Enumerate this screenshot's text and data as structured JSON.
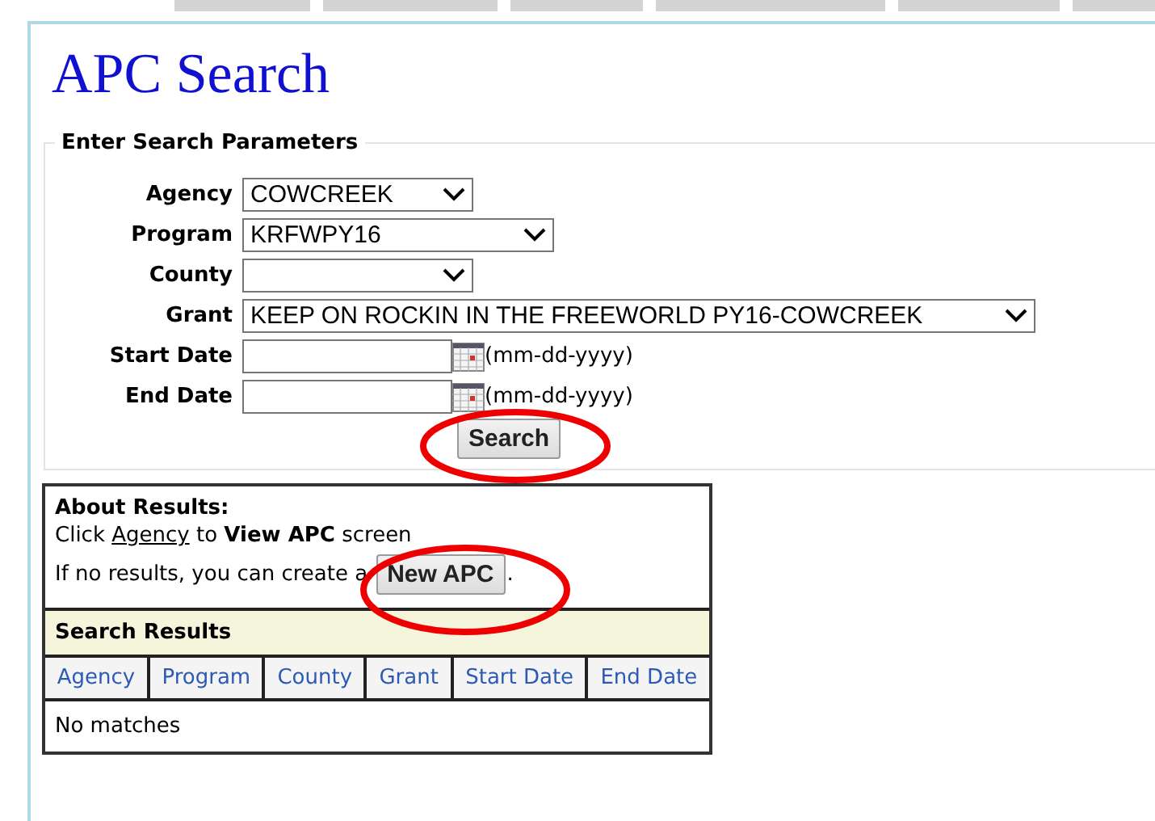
{
  "title": "APC Search",
  "search_panel": {
    "legend": "Enter Search Parameters",
    "fields": [
      {
        "kind": "select",
        "label": "Agency",
        "value": "COWCREEK"
      },
      {
        "kind": "select",
        "label": "Program",
        "value": "KRFWPY16"
      },
      {
        "kind": "select",
        "label": "County"
      },
      {
        "kind": "select",
        "label": "Grant",
        "value": "KEEP ON ROCKIN IN THE FREEWORLD PY16-COWCREEK"
      },
      {
        "kind": "date",
        "label": "Start Date",
        "hint": "(mm-dd-yyyy)"
      },
      {
        "kind": "date",
        "label": "End Date",
        "hint": "(mm-dd-yyyy)"
      }
    ],
    "button": "Search"
  },
  "about": {
    "heading": "About Results:",
    "line1_before": "Click ",
    "line1_link": "Agency",
    "line1_after": " to **View APC** screen",
    "line2": "If no results, you can create a",
    "button": "New APC",
    "line2_end": "."
  },
  "results": {
    "heading": "Search Results",
    "columns": [
      "Agency",
      "Program",
      "County",
      "Grant",
      "Start Date",
      "End Date"
    ],
    "empty": "No matches"
  }
}
